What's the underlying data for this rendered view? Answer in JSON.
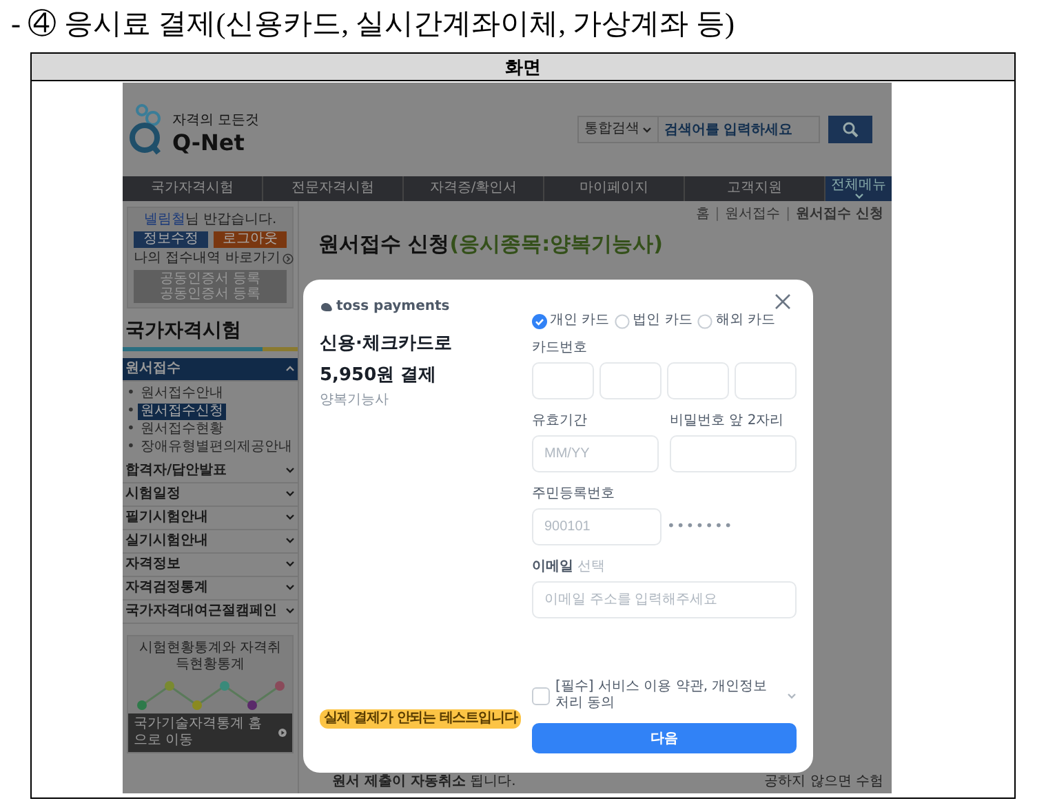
{
  "document": {
    "heading": "- ④ 응시료 결제(신용카드, 실시간계좌이체, 가상계좌 등)",
    "table_header": "화면"
  },
  "site": {
    "logo": {
      "tagline": "자격의 모든것",
      "name": "Q-Net"
    },
    "search": {
      "scope": "통합검색",
      "placeholder": "검색어를 입력하세요"
    },
    "nav": [
      "국가자격시험",
      "전문자격시험",
      "자격증/확인서",
      "마이페이지",
      "고객지원"
    ],
    "all_menu": "전체메뉴",
    "breadcrumb": [
      "홈",
      "원서접수",
      "원서접수 신청"
    ],
    "breadcrumb_separator": "|",
    "page_title": "원서접수 신청",
    "page_subtitle": "(응시종목:양복기능사)",
    "notice_fragment": "공하지 않으면 수험",
    "footer_notice": "**원서 제출이 자동취소** 됩니다."
  },
  "sidebar": {
    "greeting": {
      "name": "넬림철",
      "suffix": "님 반갑습니다."
    },
    "buttons": [
      {
        "label": "정보수정",
        "kind": "primary"
      },
      {
        "label": "로그아웃",
        "kind": "danger"
      }
    ],
    "history_link": "나의 접수내역 바로가기",
    "cert_button": [
      "공동인증서 등록",
      "공동인증서 등록"
    ],
    "section_title": "국가자격시험",
    "bullet": "•",
    "menu": [
      {
        "label": "원서접수",
        "expanded": true,
        "children": [
          {
            "label": "원서접수안내",
            "selected": false
          },
          {
            "label": "원서접수신청",
            "selected": true
          },
          {
            "label": "원서접수현황",
            "selected": false
          },
          {
            "label": "장애유형별편의제공안내",
            "selected": false
          }
        ]
      },
      {
        "label": "합격자/답안발표",
        "expanded": false
      },
      {
        "label": "시험일정",
        "expanded": false
      },
      {
        "label": "필기시험안내",
        "expanded": false
      },
      {
        "label": "실기시험안내",
        "expanded": false
      },
      {
        "label": "자격정보",
        "expanded": false
      },
      {
        "label": "자격검정통계",
        "expanded": false
      },
      {
        "label": "국가자격대여근절캠페인",
        "expanded": false
      }
    ],
    "banner": {
      "title": "시험현황통계와 자격취득현황통계",
      "link": "국가기술자격통계 홈으로 이동"
    }
  },
  "modal": {
    "brand": "toss payments",
    "title_lines": [
      "신용·체크카드로",
      "5,950원 결제"
    ],
    "item": "양복기능사",
    "test_badge": "실제 결제가 안되는 테스트입니다",
    "card_types": [
      {
        "label": "개인 카드",
        "selected": true
      },
      {
        "label": "법인 카드",
        "selected": false
      },
      {
        "label": "해외 카드",
        "selected": false
      }
    ],
    "card_number_label": "카드번호",
    "expiry": {
      "label": "유효기간",
      "placeholder": "MM/YY"
    },
    "pin": {
      "label": "비밀번호 앞 2자리"
    },
    "resident": {
      "label": "주민등록번호",
      "placeholder": "900101",
      "masked": "•••••••"
    },
    "email": {
      "label": "이메일",
      "optional": "선택",
      "placeholder": "이메일 주소를 입력해주세요"
    },
    "agreement": {
      "label": "[필수] 서비스 이용 약관, 개인정보 처리 동의",
      "checked": false
    },
    "submit": "다음"
  }
}
